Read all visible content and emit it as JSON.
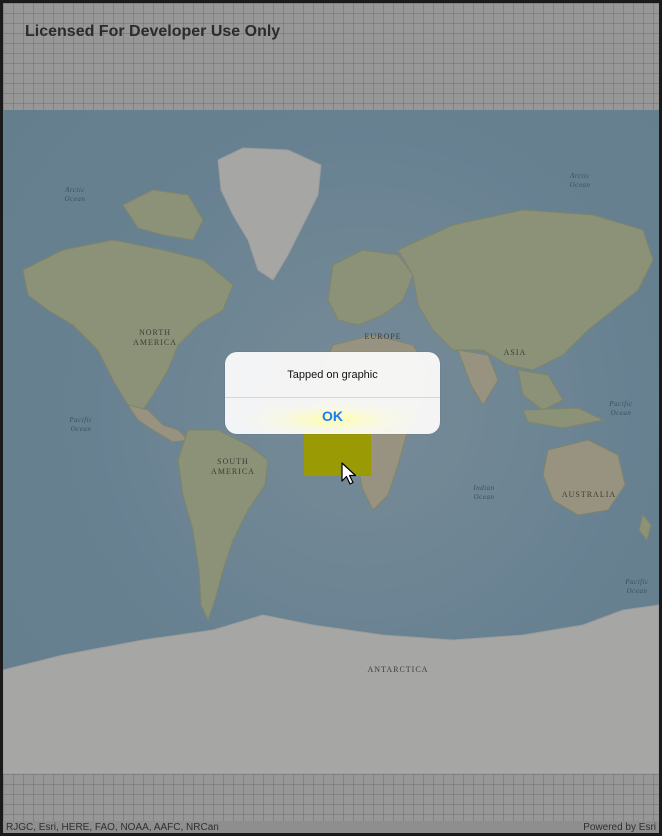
{
  "header": {
    "license_text": "Licensed For Developer Use Only"
  },
  "map": {
    "continent_labels": [
      "NORTH\nAMERICA",
      "SOUTH\nAMERICA",
      "EUROPE",
      "ASIA",
      "AUSTRALIA",
      "ANTARCTICA"
    ],
    "ocean_labels": [
      "Arctic\nOcean",
      "Arctic\nOcean",
      "Pacific\nOcean",
      "Pacific\nOcean",
      "Pacific\nOcean",
      "Indian\nOcean"
    ],
    "graphic_color": "#9a9a05"
  },
  "alert": {
    "message": "Tapped on graphic",
    "ok_label": "OK"
  },
  "footer": {
    "attribution": "RJGC, Esri, HERE, FAO, NOAA, AAFC, NRCan",
    "powered_by": "Powered by Esri"
  },
  "colors": {
    "accent": "#1a7cf2",
    "graphic": "#9a9a05"
  }
}
